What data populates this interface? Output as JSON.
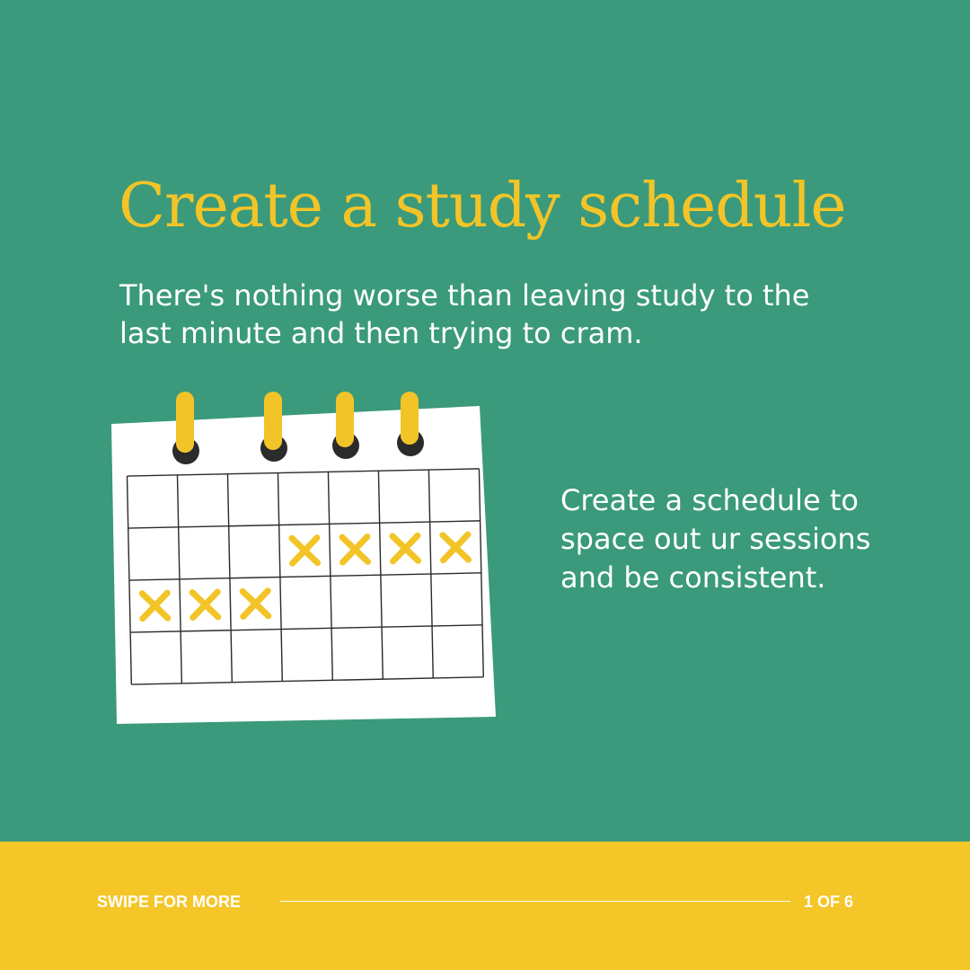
{
  "slide": {
    "title": "Create a study schedule",
    "subtitle": "There's nothing worse than leaving study to the last minute and then trying to cram.",
    "body": "Create a schedule to space out ur sessions and be consistent."
  },
  "footer": {
    "cta": "SWIPE FOR MORE",
    "page_indicator": "1 OF 6"
  },
  "calendar": {
    "rows": 4,
    "cols": 7,
    "marked_cells": [
      [
        1,
        3
      ],
      [
        1,
        4
      ],
      [
        1,
        5
      ],
      [
        1,
        6
      ],
      [
        2,
        0
      ],
      [
        2,
        1
      ],
      [
        2,
        2
      ]
    ],
    "rings": 4
  },
  "colors": {
    "background": "#3a9a7b",
    "accent": "#f3c428",
    "footer": "#f5c628",
    "text": "#ffffff"
  },
  "icons": {
    "calendar": "calendar-icon",
    "mark": "x-mark-icon",
    "ring": "binder-ring-icon"
  }
}
